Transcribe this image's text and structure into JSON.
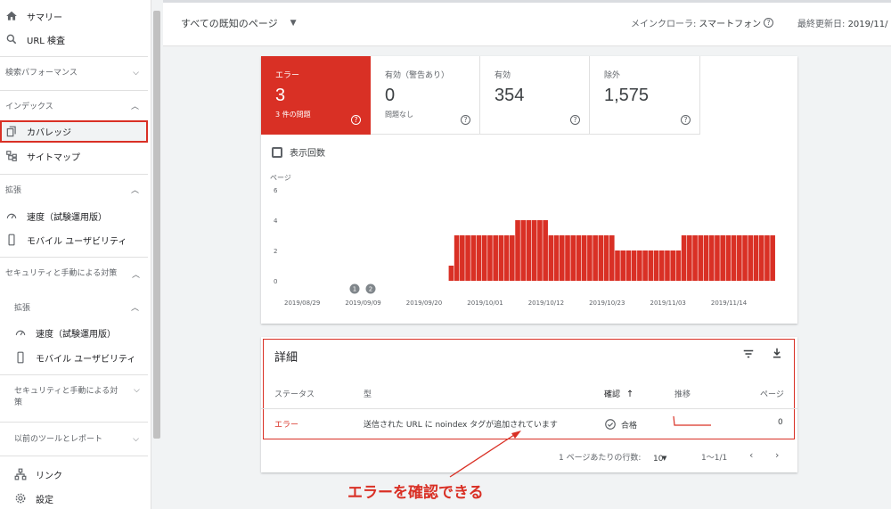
{
  "sidebar": {
    "summary": "サマリー",
    "url_inspection": "URL 検査",
    "search_performance": "検索パフォーマンス",
    "index_header": "インデックス",
    "coverage": "カバレッジ",
    "sitemaps": "サイトマップ",
    "enhancements_header": "拡張",
    "speed": "速度（試験運用版）",
    "mobile_usability": "モバイル ユーザビリティ",
    "security_header": "セキュリティと手動による対策",
    "enhancements_header_2": "拡張",
    "speed_2": "速度（試験運用版）",
    "mobile_usability_2": "モバイル ユーザビリティ",
    "security_header_2": "セキュリティと手動による対策",
    "legacy_tools": "以前のツールとレポート",
    "links": "リンク",
    "settings": "設定"
  },
  "topbar": {
    "page_filter": "すべての既知のページ",
    "crawler_label": "メインクローラ:",
    "crawler_value": "スマートフォン",
    "last_update_label": "最終更新日:",
    "last_update_value": "2019/11/"
  },
  "summary": {
    "error": {
      "label": "エラー",
      "value": "3",
      "sub": "3 件の問題"
    },
    "warning": {
      "label": "有効（警告あり）",
      "value": "0",
      "sub": "問題なし"
    },
    "valid": {
      "label": "有効",
      "value": "354"
    },
    "excluded": {
      "label": "除外",
      "value": "1,575"
    }
  },
  "impressions_label": "表示回数",
  "chart_data": {
    "type": "bar",
    "ylabel": "ページ",
    "ylim": [
      0,
      6
    ],
    "yticks": [
      "0",
      "2",
      "4",
      "6"
    ],
    "xticks": [
      "2019/08/29",
      "2019/09/09",
      "2019/09/20",
      "2019/10/01",
      "2019/10/12",
      "2019/10/23",
      "2019/11/03",
      "2019/11/14"
    ],
    "start_date": "2019/08/29",
    "values": [
      0,
      0,
      0,
      0,
      0,
      0,
      0,
      0,
      0,
      0,
      0,
      0,
      1,
      3,
      3,
      3,
      3,
      3,
      3,
      3,
      3,
      3,
      3,
      3,
      4,
      4,
      4,
      4,
      4,
      4,
      3,
      3,
      3,
      3,
      3,
      3,
      3,
      3,
      3,
      3,
      3,
      3,
      2,
      2,
      2,
      2,
      2,
      2,
      2,
      2,
      2,
      2,
      2,
      2,
      3,
      3,
      3,
      3,
      3,
      3,
      3,
      3,
      3,
      3,
      3,
      3,
      3,
      3,
      3,
      3,
      3
    ],
    "annotations": [
      "1",
      "2"
    ],
    "color": "#d93025"
  },
  "details": {
    "title": "詳細",
    "columns": {
      "status": "ステータス",
      "type": "型",
      "validation": "確認",
      "sort_arrow": "↑",
      "trend": "推移",
      "pages": "ページ"
    },
    "rows": [
      {
        "status": "エラー",
        "type": "送信された URL に noindex タグが追加されています",
        "validation": "合格",
        "pages": "0"
      }
    ],
    "pager": {
      "rows_per_page_label": "1 ページあたりの行数:",
      "rows_per_page": "10",
      "range": "1〜1/1"
    }
  },
  "annotation_text": "エラーを確認できる",
  "colors": {
    "error": "#d93025",
    "text": "#202124",
    "muted": "#5f6368"
  }
}
